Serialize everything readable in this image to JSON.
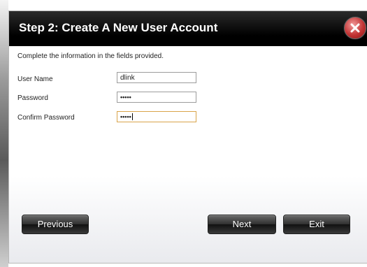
{
  "dialog": {
    "title": "Step 2: Create A New User Account",
    "instructions": "Complete the information in the fields provided."
  },
  "fields": {
    "username": {
      "label": "User Name",
      "value": "dlink"
    },
    "password": {
      "label": "Password",
      "value": "•••••"
    },
    "confirm_password": {
      "label": "Confirm Password",
      "value": "•••••"
    }
  },
  "buttons": {
    "previous": "Previous",
    "next": "Next",
    "exit": "Exit"
  },
  "icons": {
    "close": "close-icon"
  },
  "colors": {
    "title_bar": "#000000",
    "close_button": "#c23434",
    "active_field_border": "#d9a44a"
  }
}
